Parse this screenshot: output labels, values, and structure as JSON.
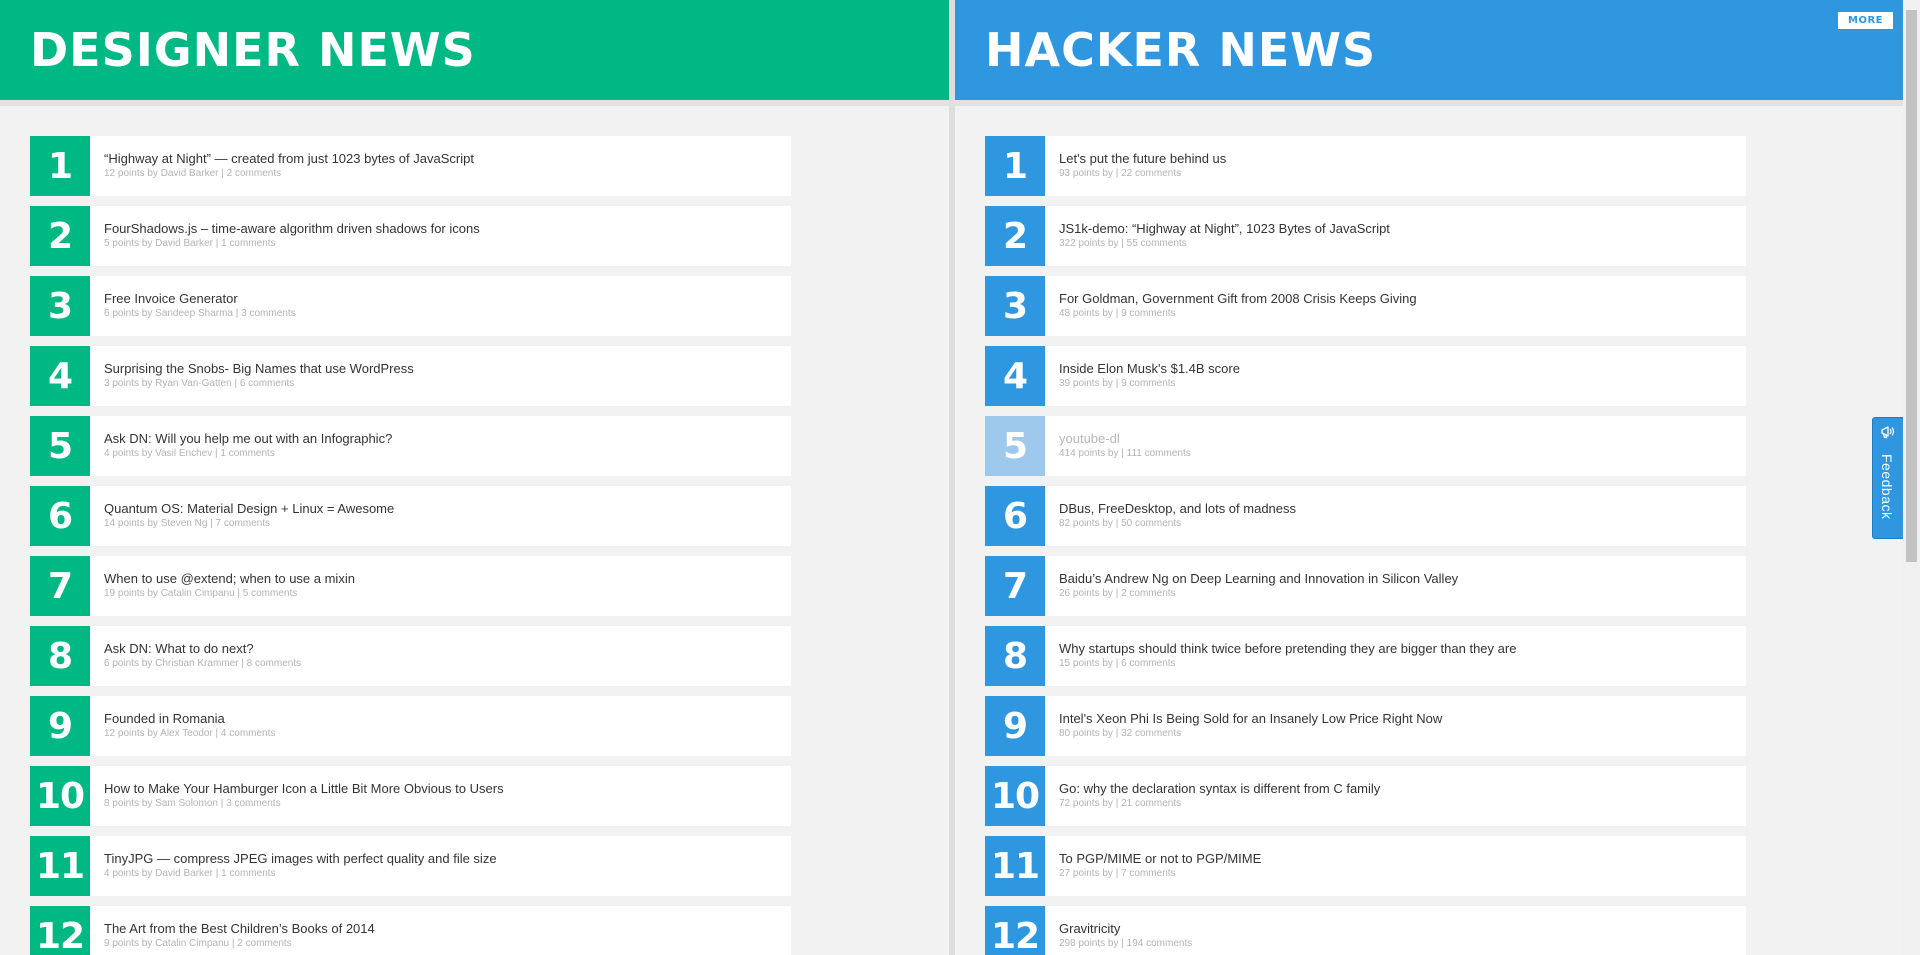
{
  "designer_news": {
    "title": "DESIGNER NEWS",
    "items": [
      {
        "rank": "1",
        "title": "“Highway at Night” — created from just 1023 bytes of JavaScript",
        "meta": "12 points by David Barker | 2 comments"
      },
      {
        "rank": "2",
        "title": "FourShadows.js – time-aware algorithm driven shadows for icons",
        "meta": "5 points by David Barker | 1 comments"
      },
      {
        "rank": "3",
        "title": "Free Invoice Generator",
        "meta": "6 points by Sandeep Sharma | 3 comments"
      },
      {
        "rank": "4",
        "title": "Surprising the Snobs- Big Names that use WordPress",
        "meta": "3 points by Ryan Van-Gatten | 6 comments"
      },
      {
        "rank": "5",
        "title": "Ask DN: Will you help me out with an Infographic?",
        "meta": "4 points by Vasil Enchev | 1 comments"
      },
      {
        "rank": "6",
        "title": "Quantum OS: Material Design + Linux = Awesome",
        "meta": "14 points by Steven Ng | 7 comments"
      },
      {
        "rank": "7",
        "title": "When to use @extend; when to use a mixin",
        "meta": "19 points by Catalin Cimpanu | 5 comments"
      },
      {
        "rank": "8",
        "title": "Ask DN: What to do next?",
        "meta": "6 points by Christian Krammer | 8 comments"
      },
      {
        "rank": "9",
        "title": "Founded in Romania",
        "meta": "12 points by Alex Teodor | 4 comments"
      },
      {
        "rank": "10",
        "title": "How to Make Your Hamburger Icon a Little Bit More Obvious to Users",
        "meta": "8 points by Sam Solomon | 3 comments"
      },
      {
        "rank": "11",
        "title": "TinyJPG — compress JPEG images with perfect quality and file size",
        "meta": "4 points by David Barker | 1 comments"
      },
      {
        "rank": "12",
        "title": "The Art from the Best Children’s Books of 2014",
        "meta": "9 points by Catalin Cimpanu | 2 comments"
      }
    ]
  },
  "hacker_news": {
    "title": "HACKER NEWS",
    "more_label": "MORE",
    "items": [
      {
        "rank": "1",
        "title": "Let's put the future behind us",
        "meta": "93 points by | 22 comments"
      },
      {
        "rank": "2",
        "title": "JS1k-demo: “Highway at Night”, 1023 Bytes of JavaScript",
        "meta": "322 points by | 55 comments"
      },
      {
        "rank": "3",
        "title": "For Goldman, Government Gift from 2008 Crisis Keeps Giving",
        "meta": "48 points by | 9 comments"
      },
      {
        "rank": "4",
        "title": "Inside Elon Musk's $1.4B score",
        "meta": "39 points by | 9 comments"
      },
      {
        "rank": "5",
        "title": "youtube-dl",
        "meta": "414 points by | 111 comments",
        "visited": true
      },
      {
        "rank": "6",
        "title": "DBus, FreeDesktop, and lots of madness",
        "meta": "82 points by | 50 comments"
      },
      {
        "rank": "7",
        "title": "Baidu’s Andrew Ng on Deep Learning and Innovation in Silicon Valley",
        "meta": "26 points by | 2 comments"
      },
      {
        "rank": "8",
        "title": "Why startups should think twice before pretending they are bigger than they are",
        "meta": "15 points by | 6 comments"
      },
      {
        "rank": "9",
        "title": "Intel's Xeon Phi Is Being Sold for an Insanely Low Price Right Now",
        "meta": "80 points by | 32 comments"
      },
      {
        "rank": "10",
        "title": "Go: why the declaration syntax is different from C family",
        "meta": "72 points by | 21 comments"
      },
      {
        "rank": "11",
        "title": "To PGP/MIME or not to PGP/MIME",
        "meta": "27 points by | 7 comments"
      },
      {
        "rank": "12",
        "title": "Gravitricity",
        "meta": "298 points by | 194 comments"
      }
    ]
  },
  "feedback": {
    "label": "Feedback",
    "icon": "megaphone-icon"
  },
  "colors": {
    "designer_green": "#00b884",
    "hacker_blue": "#2e97e0",
    "visited_blue": "#9fc9ec"
  }
}
